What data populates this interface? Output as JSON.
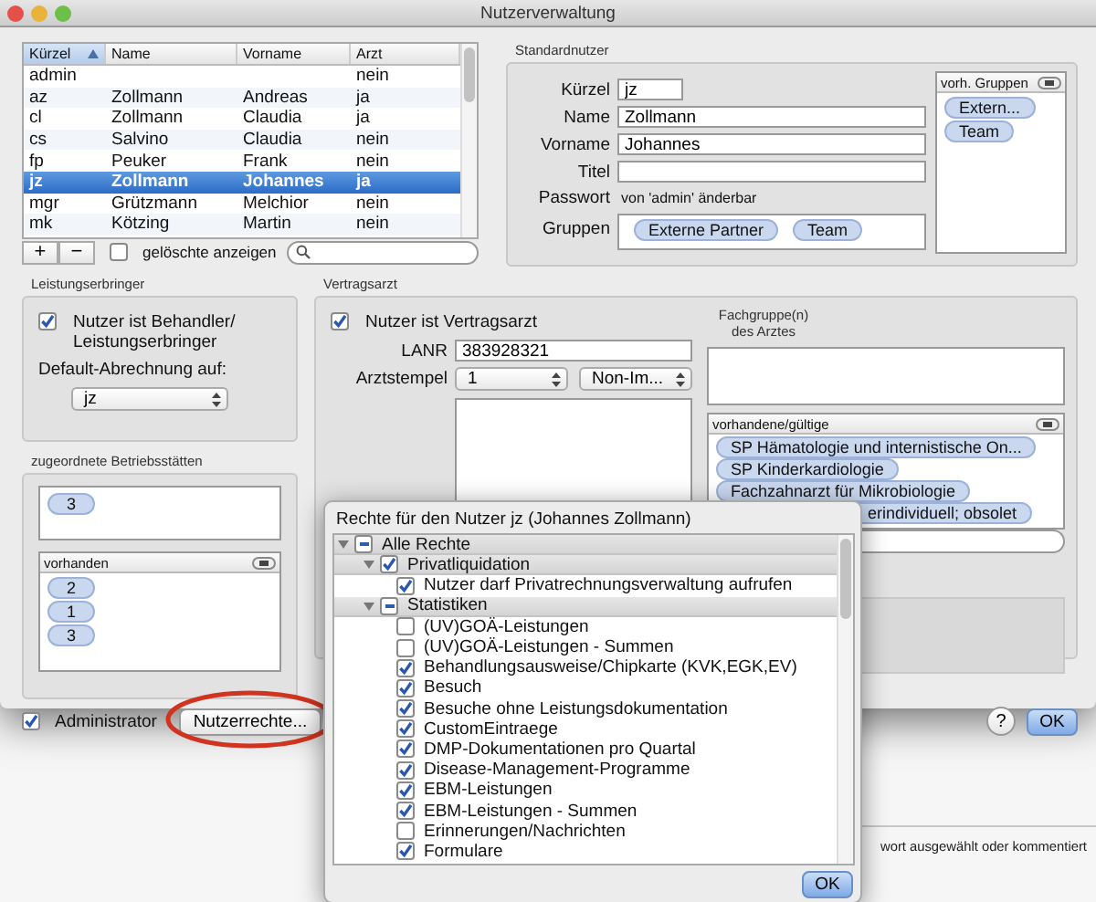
{
  "window": {
    "title": "Nutzerverwaltung"
  },
  "user_table": {
    "columns": [
      {
        "label": "Kürzel",
        "sorted": true
      },
      {
        "label": "Name",
        "sorted": false
      },
      {
        "label": "Vorname",
        "sorted": false
      },
      {
        "label": "Arzt",
        "sorted": false
      }
    ],
    "rows": [
      {
        "kuerzel": "admin",
        "arzt": "nein",
        "selected": false
      },
      {
        "kuerzel": "az",
        "name": "Zollmann",
        "vorname": "Andreas",
        "arzt": "ja",
        "selected": false
      },
      {
        "kuerzel": "cl",
        "name": "Zollmann",
        "vorname": "Claudia",
        "arzt": "ja",
        "selected": false
      },
      {
        "kuerzel": "cs",
        "name": "Salvino",
        "vorname": "Claudia",
        "arzt": "nein",
        "selected": false
      },
      {
        "kuerzel": "fp",
        "name": "Peuker",
        "vorname": "Frank",
        "arzt": "nein",
        "selected": false
      },
      {
        "kuerzel": "jz",
        "name": "Zollmann",
        "vorname": "Johannes",
        "arzt": "ja",
        "selected": true
      },
      {
        "kuerzel": "mgr",
        "name": "Grützmann",
        "vorname": "Melchior",
        "arzt": "nein",
        "selected": false
      },
      {
        "kuerzel": "mk",
        "name": "Kötzing",
        "vorname": "Martin",
        "arzt": "nein",
        "selected": false
      }
    ]
  },
  "table_toolbar": {
    "add": "+",
    "remove": "−",
    "show_deleted": {
      "label": "gelöschte anzeigen",
      "checked": false
    }
  },
  "standardnutzer": {
    "title": "Standardnutzer",
    "fields": [
      {
        "label": "Kürzel",
        "value": "jz",
        "kind": "short"
      },
      {
        "label": "Name",
        "value": "Zollmann",
        "kind": "text"
      },
      {
        "label": "Vorname",
        "value": "Johannes",
        "kind": "text"
      },
      {
        "label": "Titel",
        "kind": "text"
      }
    ],
    "password": {
      "label": "Passwort",
      "note": "von 'admin' änderbar"
    },
    "groups": {
      "label": "Gruppen",
      "tokens": [
        "Externe Partner",
        "Team"
      ]
    },
    "available_groups": {
      "header": "vorh. Gruppen",
      "tokens": [
        "Extern...",
        "Team"
      ]
    }
  },
  "leistungserbringer": {
    "title": "Leistungserbringer",
    "is_provider": {
      "label": "Nutzer ist Behandler/ Leistungserbringer",
      "checked": true
    },
    "default_label": "Default-Abrechnung auf:",
    "default_value": "jz"
  },
  "betriebsstaetten": {
    "title": "zugeordnete Betriebsstätten",
    "assigned": [
      "3"
    ],
    "available": {
      "header": "vorhanden",
      "tokens": [
        "2",
        "1",
        "3"
      ]
    }
  },
  "vertragsarzt": {
    "title": "Vertragsarzt",
    "is_contract_doctor": {
      "label": "Nutzer ist Vertragsarzt",
      "checked": true
    },
    "lanr": {
      "label": "LANR",
      "value": "383928321"
    },
    "arztstempel": {
      "label": "Arztstempel",
      "popups": [
        "1",
        "Non-Im..."
      ]
    },
    "fachgruppen": {
      "title": "Fachgruppe(n) des Arztes",
      "available": {
        "header": "vorhandene/gültige",
        "tokens": [
          {
            "text": "SP Hämatologie und internistische On...",
            "kind": "full"
          },
          {
            "text": "SP Kinderkardiologie",
            "kind": "full"
          },
          {
            "text": "Fachzahnarzt für Mikrobiologie",
            "kind": "full"
          },
          {
            "text": "erindividuell; obsolet",
            "kind": "clipped"
          }
        ]
      }
    }
  },
  "footer": {
    "administrator": {
      "label": "Administrator",
      "checked": true
    },
    "rights_button": {
      "label": "Nutzerrechte...",
      "highlighted": true
    },
    "help": "?",
    "ok": "OK"
  },
  "rights_popover": {
    "title": "Rechte für den Nutzer jz (Johannes Zollmann)",
    "ok": "OK",
    "tree": [
      {
        "label": "Alle Rechte",
        "checked": true,
        "mixed": true,
        "expanded": true,
        "children": [
          {
            "label": "Privatliquidation",
            "checked": true,
            "mixed": false,
            "expanded": true,
            "children": [
              {
                "label": "Nutzer darf Privatrechnungsverwaltung aufrufen",
                "checked": true
              }
            ]
          },
          {
            "label": "Statistiken",
            "checked": true,
            "mixed": true,
            "expanded": true,
            "children": [
              {
                "label": "(UV)GOÄ-Leistungen",
                "checked": false
              },
              {
                "label": "(UV)GOÄ-Leistungen - Summen",
                "checked": false
              },
              {
                "label": "Behandlungsausweise/Chipkarte (KVK,EGK,EV)",
                "checked": true
              },
              {
                "label": "Besuch",
                "checked": true
              },
              {
                "label": "Besuche ohne Leistungsdokumentation",
                "checked": true
              },
              {
                "label": "CustomEintraege",
                "checked": true
              },
              {
                "label": "DMP-Dokumentationen pro Quartal",
                "checked": true
              },
              {
                "label": "Disease-Management-Programme",
                "checked": true
              },
              {
                "label": "EBM-Leistungen",
                "checked": true
              },
              {
                "label": "EBM-Leistungen - Summen",
                "checked": true
              },
              {
                "label": "Erinnerungen/Nachrichten",
                "checked": false
              },
              {
                "label": "Formulare",
                "checked": true
              }
            ]
          }
        ]
      }
    ]
  },
  "background": {
    "text": "wort ausgewählt oder kommentiert"
  }
}
